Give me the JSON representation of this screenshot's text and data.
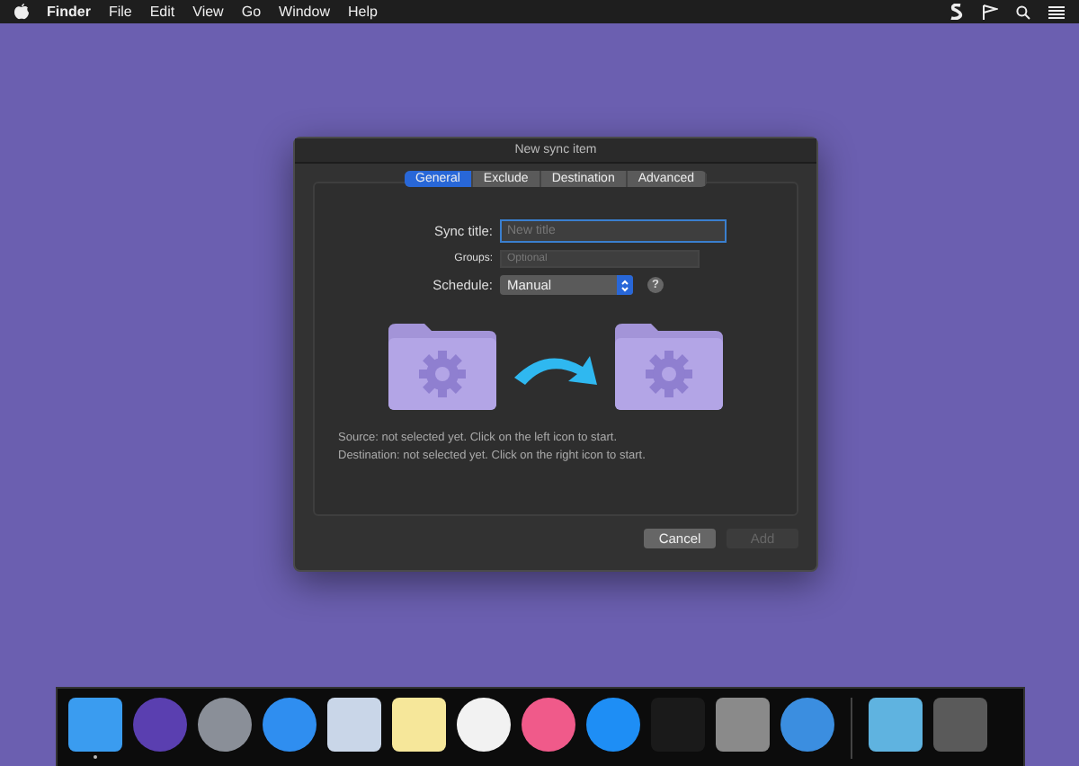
{
  "menu_bar": {
    "app": "Finder",
    "items": [
      "File",
      "Edit",
      "View",
      "Go",
      "Window",
      "Help"
    ]
  },
  "dialog": {
    "title": "New sync item",
    "tabs": [
      {
        "label": "General",
        "selected": true
      },
      {
        "label": "Exclude",
        "selected": false
      },
      {
        "label": "Destination",
        "selected": false
      },
      {
        "label": "Advanced",
        "selected": false
      }
    ],
    "sync_title": {
      "label": "Sync title:",
      "placeholder": "New title",
      "focused": true
    },
    "groups": {
      "label": "Groups:",
      "placeholder": "Optional"
    },
    "schedule": {
      "label": "Schedule:",
      "value": "Manual"
    },
    "help": "?",
    "source_note": "Source: not selected yet. Click on the left icon to start.",
    "destination_note": "Destination: not selected yet. Click on the right icon to start.",
    "buttons": [
      {
        "label": "Cancel",
        "disabled": false
      },
      {
        "label": "Add",
        "disabled": true
      }
    ]
  },
  "dock": {
    "items": [
      {
        "kind": "square",
        "color": "#3a9cf0",
        "running": true
      },
      {
        "kind": "circle",
        "color": "#5a3fb0",
        "running": false
      },
      {
        "kind": "circle",
        "color": "#8a8f98",
        "running": false
      },
      {
        "kind": "circle",
        "color": "#2f8ef0",
        "running": false
      },
      {
        "kind": "square",
        "color": "#c9d6e8",
        "running": false
      },
      {
        "kind": "square",
        "color": "#f6e79a",
        "running": false
      },
      {
        "kind": "circle",
        "color": "#f2f2f2",
        "running": false
      },
      {
        "kind": "circle",
        "color": "#f05a8a",
        "running": false
      },
      {
        "kind": "circle",
        "color": "#1e8ef5",
        "running": false
      },
      {
        "kind": "square",
        "color": "#1a1a1a",
        "running": false
      },
      {
        "kind": "square",
        "color": "#8a8a8a",
        "running": false
      },
      {
        "kind": "circle",
        "color": "#3b8ee0",
        "running": false
      },
      {
        "kind": "divider",
        "color": "#444444"
      },
      {
        "kind": "square",
        "color": "#5fb3e0",
        "running": false
      },
      {
        "kind": "square",
        "color": "#5a5a5a",
        "running": false
      }
    ]
  }
}
